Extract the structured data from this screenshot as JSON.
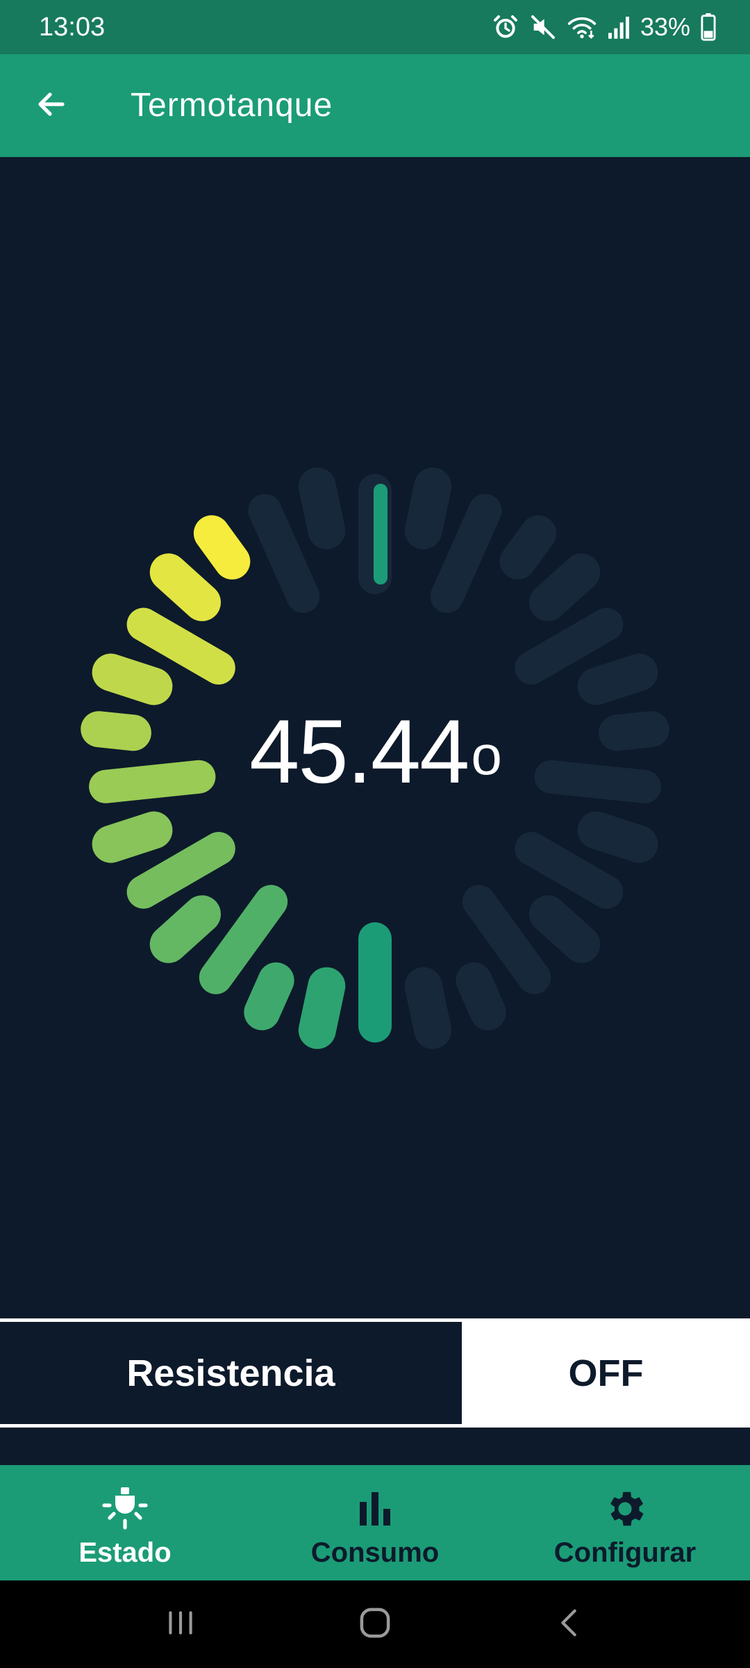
{
  "status_bar": {
    "time": "13:03",
    "battery_percent": "33%",
    "icons": [
      "alarm-icon",
      "mute-icon",
      "wifi-icon",
      "signal-icon",
      "battery-icon"
    ]
  },
  "app_bar": {
    "title": "Termotanque",
    "back_icon": "arrow-left-icon"
  },
  "gauge": {
    "value": "45.44",
    "unit": "o",
    "fill_start_fraction": 0.5,
    "fill_end_fraction": 0.9,
    "segment_count": 30,
    "colors": {
      "inactive": "#17283a",
      "start": "#1b9c76",
      "end": "#f5ec3d"
    }
  },
  "resistencia": {
    "label": "Resistencia",
    "value": "OFF"
  },
  "bottom_nav": {
    "items": [
      {
        "label": "Estado",
        "icon": "lamp-icon",
        "active": true
      },
      {
        "label": "Consumo",
        "icon": "bar-chart-icon",
        "active": false
      },
      {
        "label": "Configurar",
        "icon": "gear-icon",
        "active": false
      }
    ]
  },
  "system_nav": {
    "icons": [
      "recents-icon",
      "home-icon",
      "back-icon"
    ]
  },
  "colors": {
    "status_bar": "#177a5c",
    "app_bar": "#1b9c76",
    "background": "#0d1a2b",
    "text_light": "#ffffff",
    "text_dark": "#0d1a2b"
  }
}
